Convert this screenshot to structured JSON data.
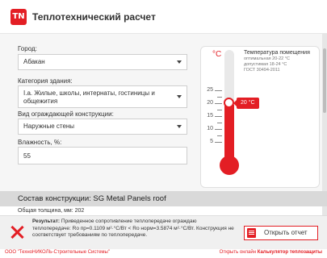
{
  "header": {
    "logo_text": "TN",
    "title": "Теплотехнический расчет"
  },
  "form": {
    "city": {
      "label": "Город:",
      "value": "Абакан"
    },
    "category": {
      "label": "Категория здания:",
      "value": "I.a. Жилые, школы, интернаты, гостиницы и общежития"
    },
    "construction": {
      "label": "Вид ограждающей конструкции:",
      "value": "Наружные стены"
    },
    "humidity": {
      "label": "Влажность, %:",
      "value": "55"
    }
  },
  "thermometer": {
    "unit": "°C",
    "title": "Температура помещения",
    "optimal": "оптимальная 20-22 °С",
    "allowed": "допустимая 18-24 °С",
    "standard": "ГОСТ 30494-2011",
    "value_label": "20 °C",
    "value": 20,
    "ticks": [
      "25",
      "20",
      "15",
      "10",
      "5"
    ],
    "accent": "#e31e24"
  },
  "composition": {
    "title": "Состав конструкции: SG Metal Panels roof",
    "thickness": "Общая толщина, мм: 202"
  },
  "result": {
    "label": "Результат:",
    "text": "Приведенное сопротивление теплопередаче ограждаю теплопередаче: Ro пр=0.1109 м²·°С/Вт < Ro норм=3.5874 м²·°С/Вт. Конструкция не соответствует требованиям по теплопередаче.",
    "icon": "error-x-icon",
    "report_button": "Открыть отчет"
  },
  "footer": {
    "company": "ООО \"ТехноНИКОЛЬ-Строительные Системы\"",
    "online_prefix": "Открыть онлайн",
    "online_link": "Калькулятор теплозащиты"
  }
}
